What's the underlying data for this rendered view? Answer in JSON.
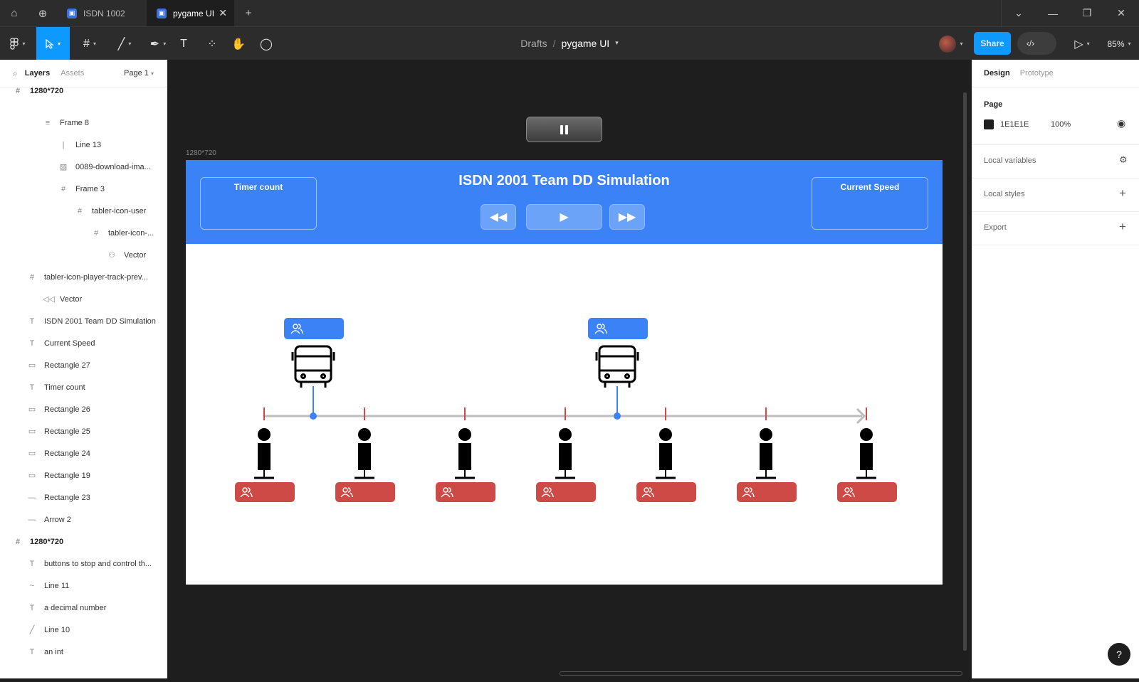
{
  "tabs": [
    {
      "label": "ISDN 1002"
    },
    {
      "label": "pygame UI"
    }
  ],
  "toolbar": {
    "breadcrumb_parent": "Drafts",
    "breadcrumb_sep": "/",
    "file_name": "pygame UI",
    "share_label": "Share",
    "zoom": "85%"
  },
  "left_panel": {
    "tab_layers": "Layers",
    "tab_assets": "Assets",
    "page_select": "Page 1",
    "layers": [
      {
        "label": "1280*720",
        "icon": "frame-icon"
      },
      {
        "label": "Frame 8",
        "icon": "auto-layout-icon"
      },
      {
        "label": "Line 13",
        "icon": "line-icon"
      },
      {
        "label": "0089-download-ima...",
        "icon": "image-icon"
      },
      {
        "label": "Frame 3",
        "icon": "frame-icon"
      },
      {
        "label": "tabler-icon-user",
        "icon": "frame-icon"
      },
      {
        "label": "tabler-icon-...",
        "icon": "frame-icon"
      },
      {
        "label": "Vector",
        "icon": "vector-users-icon"
      },
      {
        "label": "tabler-icon-player-track-prev...",
        "icon": "frame-icon"
      },
      {
        "label": "Vector",
        "icon": "vector-rewind-icon"
      },
      {
        "label": "ISDN 2001 Team DD Simulation",
        "icon": "text-icon"
      },
      {
        "label": "Current Speed",
        "icon": "text-icon"
      },
      {
        "label": "Rectangle 27",
        "icon": "rectangle-icon"
      },
      {
        "label": "Timer count",
        "icon": "text-icon"
      },
      {
        "label": "Rectangle 26",
        "icon": "rectangle-icon"
      },
      {
        "label": "Rectangle 25",
        "icon": "rectangle-icon"
      },
      {
        "label": "Rectangle 24",
        "icon": "rectangle-icon"
      },
      {
        "label": "Rectangle 19",
        "icon": "rectangle-icon"
      },
      {
        "label": "Rectangle 23",
        "icon": "line-h-icon"
      },
      {
        "label": "Arrow 2",
        "icon": "arrow-icon"
      },
      {
        "label": "1280*720",
        "icon": "frame-icon"
      },
      {
        "label": "buttons to stop and control th...",
        "icon": "text-icon"
      },
      {
        "label": "Line 11",
        "icon": "curve-icon"
      },
      {
        "label": "a decimal number",
        "icon": "text-icon"
      },
      {
        "label": "Line 10",
        "icon": "diagonal-line-icon"
      },
      {
        "label": "an int",
        "icon": "text-icon"
      }
    ]
  },
  "right_panel": {
    "tab_design": "Design",
    "tab_prototype": "Prototype",
    "page_heading": "Page",
    "page_color": "1E1E1E",
    "page_color_hex": "#1e1e1e",
    "page_opacity": "100%",
    "local_variables": "Local variables",
    "local_styles": "Local styles",
    "export": "Export"
  },
  "canvas": {
    "frame_label": "1280*720",
    "title": "ISDN 2001 Team DD Simulation",
    "timer_label": "Timer count",
    "speed_label": "Current Speed",
    "bus_count": 2,
    "stop_count": 7
  },
  "colors": {
    "accent": "#0d99ff",
    "header_blue": "#3b82f6",
    "stop_red": "#cd4a46"
  }
}
